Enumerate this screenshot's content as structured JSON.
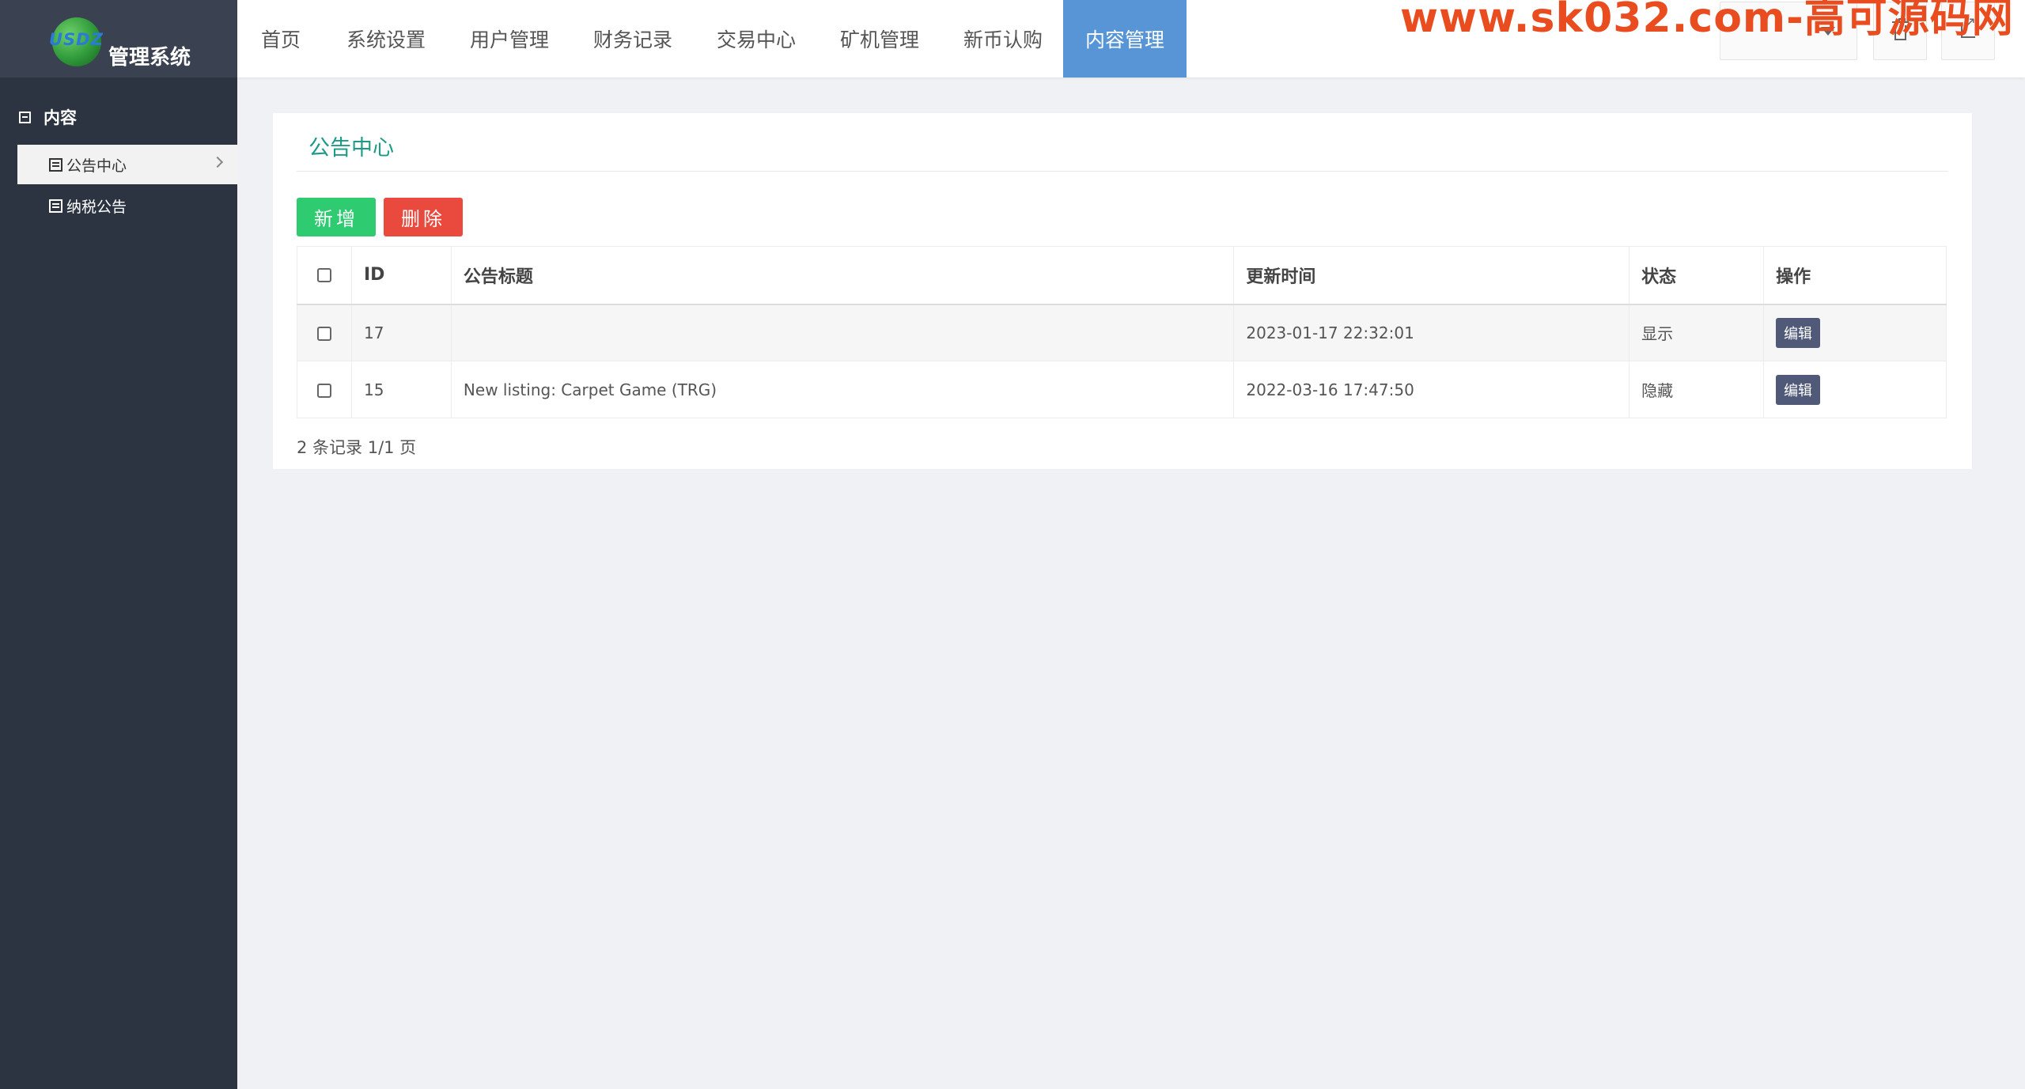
{
  "app": {
    "logo_text": "USDZ",
    "title": "管理系统"
  },
  "sidebar": {
    "section_label": "内容",
    "items": [
      {
        "label": "公告中心",
        "active": true
      },
      {
        "label": "纳税公告",
        "active": false
      }
    ]
  },
  "topnav": {
    "items": [
      {
        "label": "首页",
        "active": false
      },
      {
        "label": "系统设置",
        "active": false
      },
      {
        "label": "用户管理",
        "active": false
      },
      {
        "label": "财务记录",
        "active": false
      },
      {
        "label": "交易中心",
        "active": false
      },
      {
        "label": "矿机管理",
        "active": false
      },
      {
        "label": "新币认购",
        "active": false
      },
      {
        "label": "内容管理",
        "active": true
      }
    ]
  },
  "watermark": "www.sk032.com-高可源码网",
  "panel": {
    "title": "公告中心",
    "add_label": "新增",
    "delete_label": "删除",
    "columns": [
      "ID",
      "公告标题",
      "更新时间",
      "状态",
      "操作"
    ],
    "rows": [
      {
        "id": "17",
        "title": "",
        "updated": "2023-01-17 22:32:01",
        "status": "显示",
        "action": "编辑"
      },
      {
        "id": "15",
        "title": "New listing: Carpet Game (TRG)",
        "updated": "2022-03-16 17:47:50",
        "status": "隐藏",
        "action": "编辑"
      }
    ],
    "footer": "2 条记录 1/1 页"
  },
  "colors": {
    "sidebar": "#2c3442",
    "nav_active": "#5795d7",
    "title": "#1d9b86",
    "add": "#2ecb70",
    "delete": "#ea4a3d",
    "edit": "#505a78",
    "watermark": "#e94c1e"
  }
}
